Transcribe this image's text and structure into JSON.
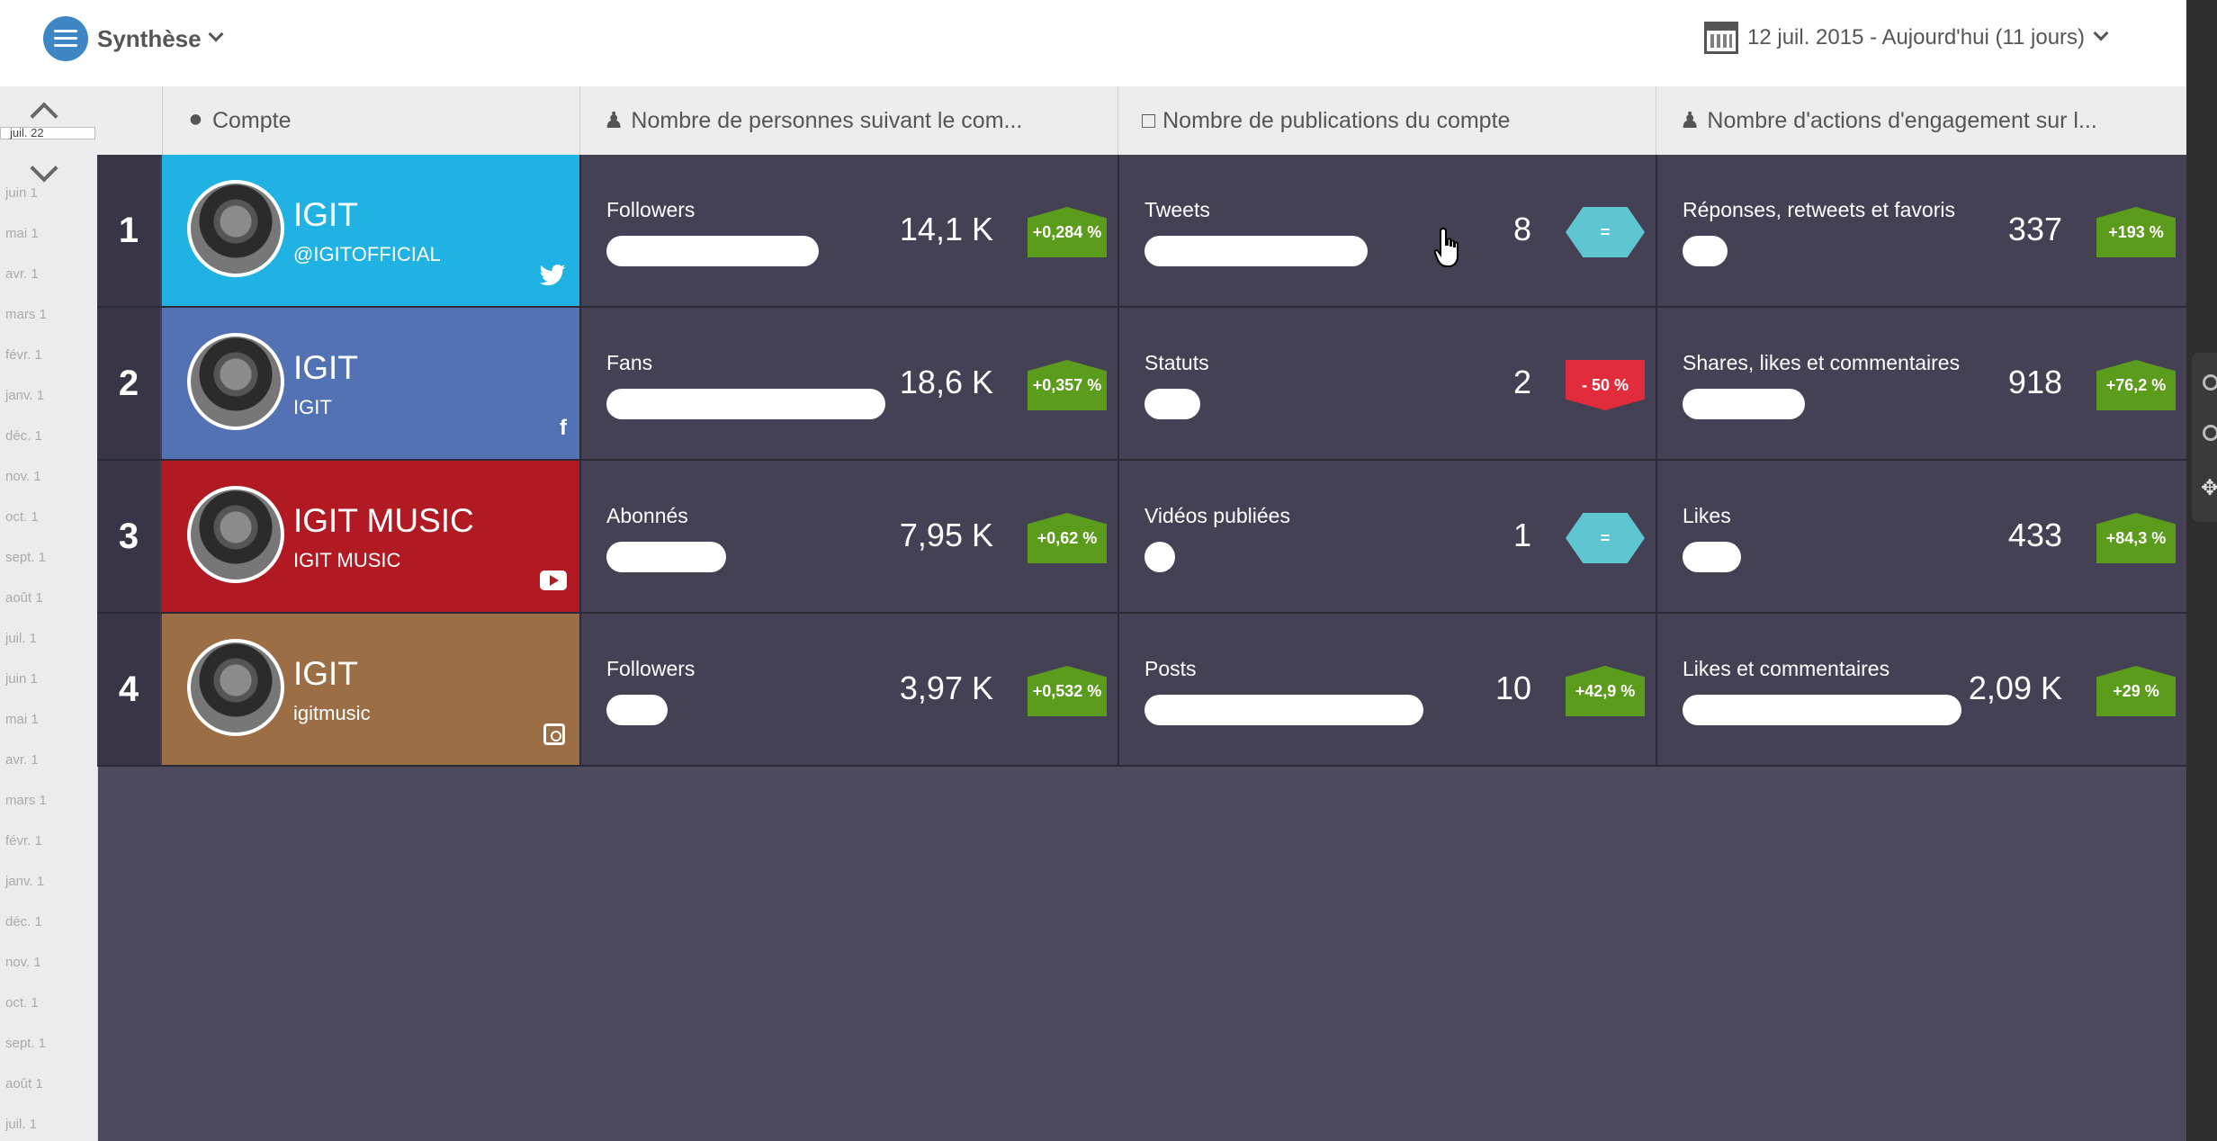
{
  "header": {
    "menu_title": "Synthèse",
    "date_range": "12 juil. 2015 - Aujourd'hui (11 jours)"
  },
  "timeline": {
    "current": "juil. 22",
    "months": [
      "juin 1",
      "mai 1",
      "avr. 1",
      "mars 1",
      "févr. 1",
      "janv. 1",
      "déc. 1",
      "nov. 1",
      "oct. 1",
      "sept. 1",
      "août 1",
      "juil. 1",
      "juin 1",
      "mai 1",
      "avr. 1",
      "mars 1",
      "févr. 1",
      "janv. 1",
      "déc. 1",
      "nov. 1",
      "oct. 1",
      "sept. 1",
      "août 1",
      "juil. 1"
    ]
  },
  "columns": {
    "account": "Compte",
    "followers": "Nombre de personnes suivant le com...",
    "posts": "Nombre de publications du compte",
    "engagement": "Nombre d'actions d'engagement sur l..."
  },
  "rows": [
    {
      "rank": "1",
      "name": "IGIT",
      "handle": "@IGITOFFICIAL",
      "network": "twitter",
      "color": "#1fb2e2",
      "followers": {
        "label": "Followers",
        "value": "14,1 K",
        "change": "+0,284 %",
        "bar": 0.76
      },
      "posts": {
        "label": "Tweets",
        "value": "8",
        "change": "=",
        "bar": 0.8
      },
      "engagement": {
        "label": "Réponses, retweets et favoris",
        "value": "337",
        "change": "+193 %",
        "bar": 0.16
      }
    },
    {
      "rank": "2",
      "name": "IGIT",
      "handle": "IGIT",
      "network": "facebook",
      "color": "#5272b4",
      "followers": {
        "label": "Fans",
        "value": "18,6 K",
        "change": "+0,357 %",
        "bar": 1.0
      },
      "posts": {
        "label": "Statuts",
        "value": "2",
        "change": "- 50 %",
        "bar": 0.2
      },
      "engagement": {
        "label": "Shares, likes et commentaires",
        "value": "918",
        "change": "+76,2 %",
        "bar": 0.44
      }
    },
    {
      "rank": "3",
      "name": "IGIT MUSIC",
      "handle": "IGIT MUSIC",
      "network": "youtube",
      "color": "#b11a22",
      "followers": {
        "label": "Abonnés",
        "value": "7,95 K",
        "change": "+0,62 %",
        "bar": 0.43
      },
      "posts": {
        "label": "Vidéos publiées",
        "value": "1",
        "change": "=",
        "bar": 0.1
      },
      "engagement": {
        "label": "Likes",
        "value": "433",
        "change": "+84,3 %",
        "bar": 0.21
      }
    },
    {
      "rank": "4",
      "name": "IGIT",
      "handle": "igitmusic",
      "network": "instagram",
      "color": "#9b6e45",
      "followers": {
        "label": "Followers",
        "value": "3,97 K",
        "change": "+0,532 %",
        "bar": 0.22
      },
      "posts": {
        "label": "Posts",
        "value": "10",
        "change": "+42,9 %",
        "bar": 1.0
      },
      "engagement": {
        "label": "Likes et commentaires",
        "value": "2,09 K",
        "change": "+29 %",
        "bar": 1.0
      }
    }
  ],
  "colors": {
    "badge_positive": "#5c9c1c",
    "badge_neutral": "#5ec6d1",
    "badge_negative": "#e22b3b",
    "row_background": "#454155"
  }
}
